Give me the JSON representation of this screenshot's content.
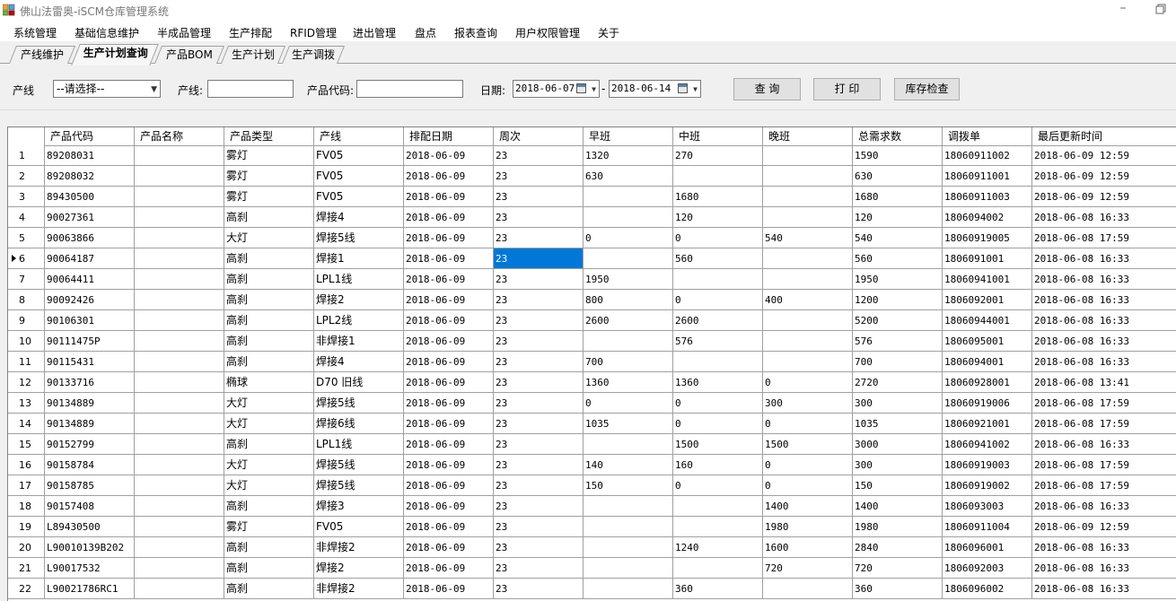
{
  "window": {
    "title": "佛山法雷奥-iSCM仓库管理系统",
    "minimize": "–"
  },
  "menu": [
    "系统管理",
    "基础信息维护",
    "半成品管理",
    "生产排配",
    "RFID管理",
    "进出管理",
    "盘点",
    "报表查询",
    "用户权限管理",
    "关于"
  ],
  "tabs": [
    "产线维护",
    "生产计划查询",
    "产品BOM",
    "生产计划",
    "生产调拨"
  ],
  "active_tab": 1,
  "filters": {
    "line_label": "产线",
    "line_select": "--请选择--",
    "line_text_label": "产线:",
    "line_text_value": "",
    "code_label": "产品代码:",
    "code_value": "",
    "date_label": "日期:",
    "date_from": "2018-06-07",
    "date_sep": "-",
    "date_to": "2018-06-14",
    "query_button": "查 询",
    "print_button": "打 印",
    "stock_button": "库存检查"
  },
  "columns": [
    "产品代码",
    "产品名称",
    "产品类型",
    "产线",
    "排配日期",
    "周次",
    "早班",
    "中班",
    "晚班",
    "总需求数",
    "调拨单",
    "最后更新时间"
  ],
  "selected_row": 6,
  "selected_col": 5,
  "rows": [
    {
      "n": "1",
      "c": [
        "89208031",
        "",
        "雾灯",
        "FV05",
        "2018-06-09",
        "23",
        "1320",
        "270",
        "",
        "1590",
        "18060911002",
        "2018-06-09 12:59"
      ]
    },
    {
      "n": "2",
      "c": [
        "89208032",
        "",
        "雾灯",
        "FV05",
        "2018-06-09",
        "23",
        "630",
        "",
        "",
        "630",
        "18060911001",
        "2018-06-09 12:59"
      ]
    },
    {
      "n": "3",
      "c": [
        "89430500",
        "",
        "雾灯",
        "FV05",
        "2018-06-09",
        "23",
        "",
        "1680",
        "",
        "1680",
        "18060911003",
        "2018-06-09 12:59"
      ]
    },
    {
      "n": "4",
      "c": [
        "90027361",
        "",
        "高刹",
        "焊接4",
        "2018-06-09",
        "23",
        "",
        "120",
        "",
        "120",
        "1806094002",
        "2018-06-08 16:33"
      ]
    },
    {
      "n": "5",
      "c": [
        "90063866",
        "",
        "大灯",
        "焊接5线",
        "2018-06-09",
        "23",
        "0",
        "0",
        "540",
        "540",
        "18060919005",
        "2018-06-08 17:59"
      ]
    },
    {
      "n": "6",
      "c": [
        "90064187",
        "",
        "高刹",
        "焊接1",
        "2018-06-09",
        "23",
        "",
        "560",
        "",
        "560",
        "1806091001",
        "2018-06-08 16:33"
      ]
    },
    {
      "n": "7",
      "c": [
        "90064411",
        "",
        "高刹",
        "LPL1线",
        "2018-06-09",
        "23",
        "1950",
        "",
        "",
        "1950",
        "18060941001",
        "2018-06-08 16:33"
      ]
    },
    {
      "n": "8",
      "c": [
        "90092426",
        "",
        "高刹",
        "焊接2",
        "2018-06-09",
        "23",
        "800",
        "0",
        "400",
        "1200",
        "1806092001",
        "2018-06-08 16:33"
      ]
    },
    {
      "n": "9",
      "c": [
        "90106301",
        "",
        "高刹",
        "LPL2线",
        "2018-06-09",
        "23",
        "2600",
        "2600",
        "",
        "5200",
        "18060944001",
        "2018-06-08 16:33"
      ]
    },
    {
      "n": "10",
      "c": [
        "90111475P",
        "",
        "高刹",
        "非焊接1",
        "2018-06-09",
        "23",
        "",
        "576",
        "",
        "576",
        "1806095001",
        "2018-06-08 16:33"
      ]
    },
    {
      "n": "11",
      "c": [
        "90115431",
        "",
        "高刹",
        "焊接4",
        "2018-06-09",
        "23",
        "700",
        "",
        "",
        "700",
        "1806094001",
        "2018-06-08 16:33"
      ]
    },
    {
      "n": "12",
      "c": [
        "90133716",
        "",
        "椭球",
        "D70 旧线",
        "2018-06-09",
        "23",
        "1360",
        "1360",
        "0",
        "2720",
        "18060928001",
        "2018-06-08 13:41"
      ]
    },
    {
      "n": "13",
      "c": [
        "90134889",
        "",
        "大灯",
        "焊接5线",
        "2018-06-09",
        "23",
        "0",
        "0",
        "300",
        "300",
        "18060919006",
        "2018-06-08 17:59"
      ]
    },
    {
      "n": "14",
      "c": [
        "90134889",
        "",
        "大灯",
        "焊接6线",
        "2018-06-09",
        "23",
        "1035",
        "0",
        "0",
        "1035",
        "18060921001",
        "2018-06-08 17:59"
      ]
    },
    {
      "n": "15",
      "c": [
        "90152799",
        "",
        "高刹",
        "LPL1线",
        "2018-06-09",
        "23",
        "",
        "1500",
        "1500",
        "3000",
        "18060941002",
        "2018-06-08 16:33"
      ]
    },
    {
      "n": "16",
      "c": [
        "90158784",
        "",
        "大灯",
        "焊接5线",
        "2018-06-09",
        "23",
        "140",
        "160",
        "0",
        "300",
        "18060919003",
        "2018-06-08 17:59"
      ]
    },
    {
      "n": "17",
      "c": [
        "90158785",
        "",
        "大灯",
        "焊接5线",
        "2018-06-09",
        "23",
        "150",
        "0",
        "0",
        "150",
        "18060919002",
        "2018-06-08 17:59"
      ]
    },
    {
      "n": "18",
      "c": [
        "90157408",
        "",
        "高刹",
        "焊接3",
        "2018-06-09",
        "23",
        "",
        "",
        "1400",
        "1400",
        "1806093003",
        "2018-06-08 16:33"
      ]
    },
    {
      "n": "19",
      "c": [
        "L89430500",
        "",
        "雾灯",
        "FV05",
        "2018-06-09",
        "23",
        "",
        "",
        "1980",
        "1980",
        "18060911004",
        "2018-06-09 12:59"
      ]
    },
    {
      "n": "20",
      "c": [
        "L90010139B202",
        "",
        "高刹",
        "非焊接2",
        "2018-06-09",
        "23",
        "",
        "1240",
        "1600",
        "2840",
        "1806096001",
        "2018-06-08 16:33"
      ]
    },
    {
      "n": "21",
      "c": [
        "L90017532",
        "",
        "高刹",
        "焊接2",
        "2018-06-09",
        "23",
        "",
        "",
        "720",
        "720",
        "1806092003",
        "2018-06-08 16:33"
      ]
    },
    {
      "n": "22",
      "c": [
        "L90021786RC1",
        "",
        "高刹",
        "非焊接2",
        "2018-06-09",
        "23",
        "",
        "360",
        "",
        "360",
        "1806096002",
        "2018-06-08 16:33"
      ]
    }
  ],
  "colors": {
    "selection": "#0078d7",
    "grid_line": "#a0a0a0"
  }
}
